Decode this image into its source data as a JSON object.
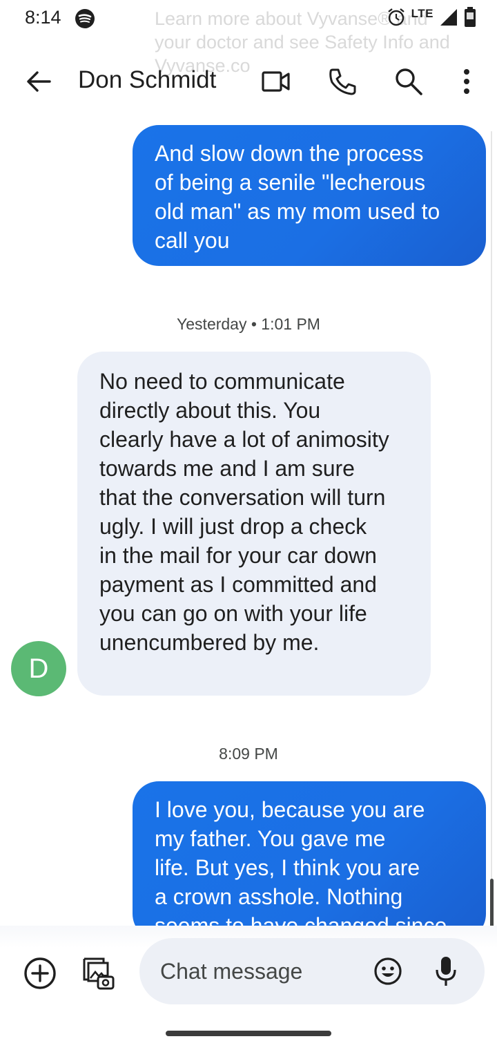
{
  "status_bar": {
    "time": "8:14",
    "network": "LTE",
    "notification_ghost": "Learn more about Vyvanse® and\nyour doctor and see Safety Info and\nVyvanse.co"
  },
  "header": {
    "contact_name": "Don Schmidt",
    "icons": [
      "back-arrow-icon",
      "video-call-icon",
      "phone-icon",
      "search-icon",
      "more-vert-icon"
    ]
  },
  "conversation": {
    "messages": [
      {
        "direction": "outgoing",
        "text": "And slow down the process\nof being a senile \"lecherous\nold man\" as my mom used to\ncall you"
      },
      {
        "direction": "incoming",
        "text": "No need to communicate\ndirectly about this. You\nclearly have a lot of animosity\ntowards me and I am sure\nthat the conversation will turn\nugly. I will just drop a check\nin the mail for your car down\npayment as I committed and\nyou can go on with your life\nunencumbered by me."
      },
      {
        "direction": "outgoing",
        "text": "I love you, because you are\nmy father. You gave me\nlife. But yes, I think you are\na crown asshole. Nothing\nseems to have changed since"
      }
    ],
    "timestamps": [
      "Yesterday • 1:01 PM",
      "8:09 PM"
    ],
    "avatar_letter": "D",
    "avatar_color": "#5bb974"
  },
  "composer": {
    "placeholder": "Chat message"
  },
  "colors": {
    "outgoing_bubble": "#1a73e8",
    "incoming_bubble": "#ecf0f8",
    "background": "#ffffff"
  }
}
